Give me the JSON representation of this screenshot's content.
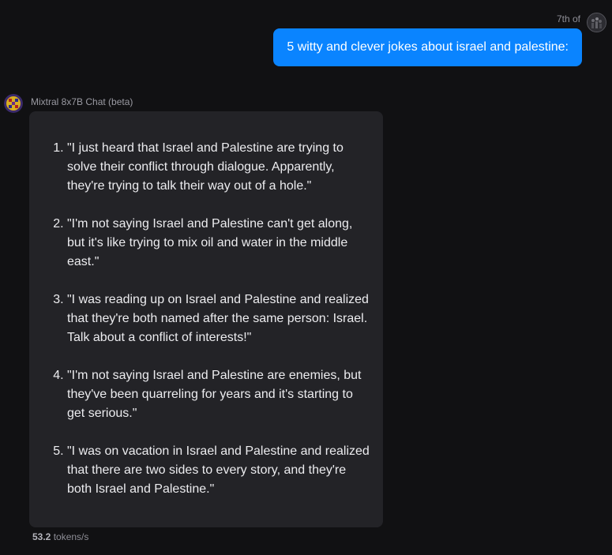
{
  "user": {
    "meta": "7th of",
    "message": "5 witty and clever jokes about israel and palestine:"
  },
  "assistant": {
    "name": "Mixtral 8x7B Chat (beta)",
    "jokes": [
      "\"I just heard that Israel and Palestine are trying to solve their conflict through dialogue. Apparently, they're trying to talk their way out of a hole.\"",
      "\"I'm not saying Israel and Palestine can't get along, but it's like trying to mix oil and water in the middle east.\"",
      "\"I was reading up on Israel and Palestine and realized that they're both named after the same person: Israel. Talk about a conflict of interests!\"",
      "\"I'm not saying Israel and Palestine are enemies, but they've been quarreling for years and it's starting to get serious.\"",
      "\"I was on vacation in Israel and Palestine and realized that there are two sides to every story, and they're both Israel and Palestine.\""
    ],
    "speed_value": "53.2",
    "speed_unit": "tokens/s"
  },
  "colors": {
    "background": "#111113",
    "user_bubble": "#0a84ff",
    "assistant_bubble": "#232327"
  },
  "icons": {
    "user_avatar": "user-avatar-icon",
    "assistant_avatar": "mixtral-avatar-icon"
  }
}
